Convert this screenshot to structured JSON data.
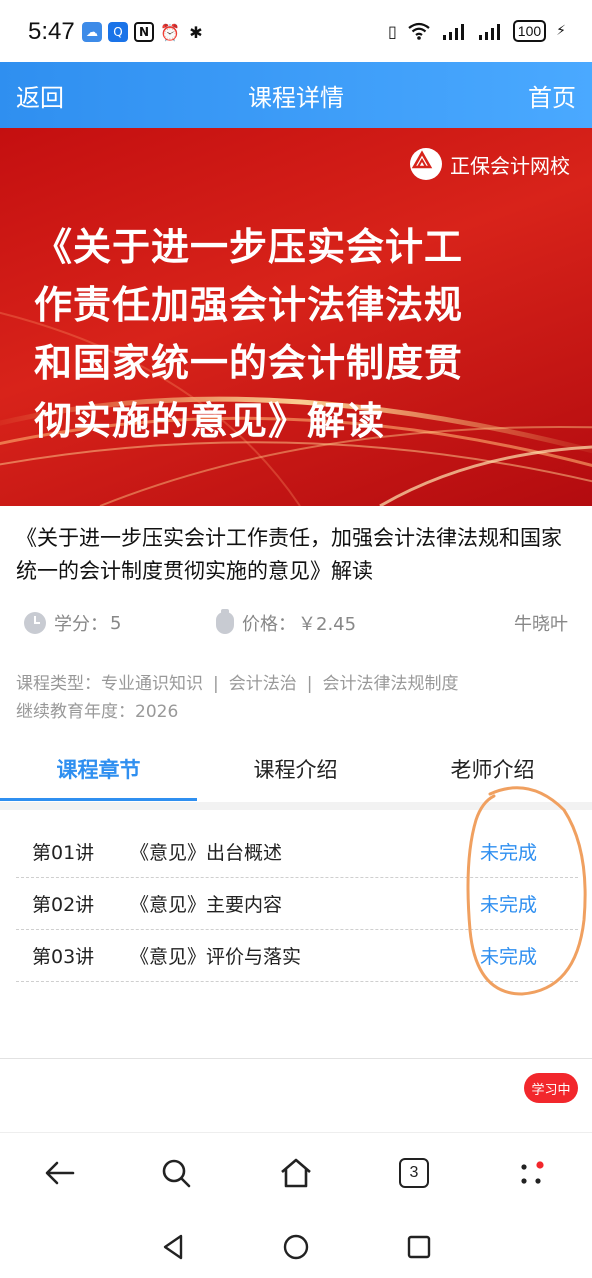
{
  "status_bar": {
    "time": "5:47",
    "battery": "100",
    "icons_left": [
      "weather-icon",
      "search-app-icon",
      "nfc-icon",
      "alarm-icon",
      "bluetooth-icon"
    ],
    "icons_right": [
      "vibrate-icon",
      "wifi-icon",
      "signal-icon",
      "signal-icon",
      "battery-icon",
      "charging-icon"
    ]
  },
  "navbar": {
    "back_label": "返回",
    "title": "课程详情",
    "home_label": "首页",
    "color": "#2f8ff0"
  },
  "banner": {
    "brand": "正保会计网校",
    "title_lines": [
      "《关于进一步压实会计工",
      "作责任加强会计法律法规",
      "和国家统一的会计制度贯",
      "彻实施的意见》解读"
    ],
    "background_color": "#d8231a"
  },
  "course": {
    "title": "《关于进一步压实会计工作责任，加强会计法律法规和国家统一的会计制度贯彻实施的意见》解读",
    "credit_label": "学分：",
    "credit_value": "5",
    "price_label": "价格：",
    "price_value": "￥2.45",
    "teacher": "牛晓叶",
    "type_label": "课程类型：",
    "types": [
      "专业通识知识",
      "会计法治",
      "会计法律法规制度"
    ],
    "type_separator": "|",
    "year_label": "继续教育年度：",
    "year_value": "2026"
  },
  "tabs": [
    {
      "label": "课程章节",
      "active": true
    },
    {
      "label": "课程介绍",
      "active": false
    },
    {
      "label": "老师介绍",
      "active": false
    }
  ],
  "chapters": [
    {
      "no": "第01讲",
      "name": "《意见》出台概述",
      "status": "未完成"
    },
    {
      "no": "第02讲",
      "name": "《意见》主要内容",
      "status": "未完成"
    },
    {
      "no": "第03讲",
      "name": "《意见》评价与落实",
      "status": "未完成"
    }
  ],
  "study_badge": "学习中",
  "browser_bar": {
    "buttons": [
      "back-arrow-icon",
      "search-icon",
      "home-icon",
      "tabs-icon",
      "more-menu-icon"
    ],
    "tab_count": "3"
  },
  "system_nav": [
    "back-triangle-icon",
    "home-circle-icon",
    "recents-square-icon"
  ],
  "accent_color": "#2f8ff0",
  "annotation_color": "#f0a060"
}
